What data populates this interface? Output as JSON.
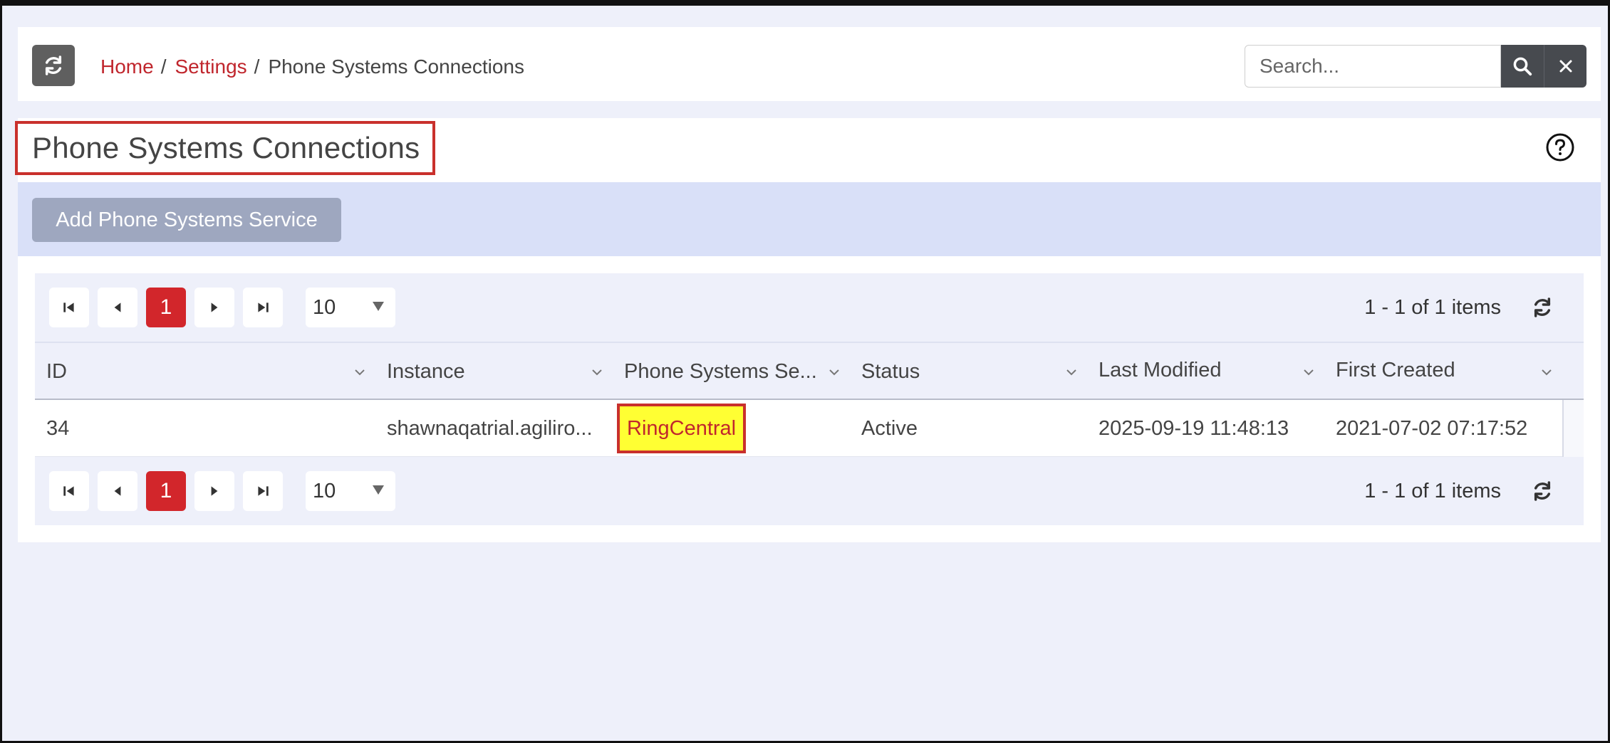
{
  "breadcrumb": {
    "items": [
      {
        "label": "Home",
        "link": true
      },
      {
        "label": "Settings",
        "link": true
      },
      {
        "label": "Phone Systems Connections",
        "link": false
      }
    ],
    "separator": "/"
  },
  "search": {
    "placeholder": "Search..."
  },
  "page": {
    "title": "Phone Systems Connections",
    "add_button_label": "Add Phone Systems Service"
  },
  "pager": {
    "current_page": "1",
    "page_size": "10",
    "info": "1 - 1 of 1 items"
  },
  "table": {
    "columns": [
      "ID",
      "Instance",
      "Phone Systems Se...",
      "Status",
      "Last Modified",
      "First Created"
    ],
    "rows": [
      {
        "id": "34",
        "instance": "shawnaqatrial.agiliro...",
        "service": "RingCentral",
        "status": "Active",
        "last_modified": "2025-09-19 11:48:13",
        "first_created": "2021-07-02 07:17:52"
      }
    ]
  },
  "colors": {
    "accent_red": "#d2262b",
    "link_red": "#c0262d",
    "highlight_yellow": "#ffff33",
    "action_bar": "#d9e0f8"
  }
}
